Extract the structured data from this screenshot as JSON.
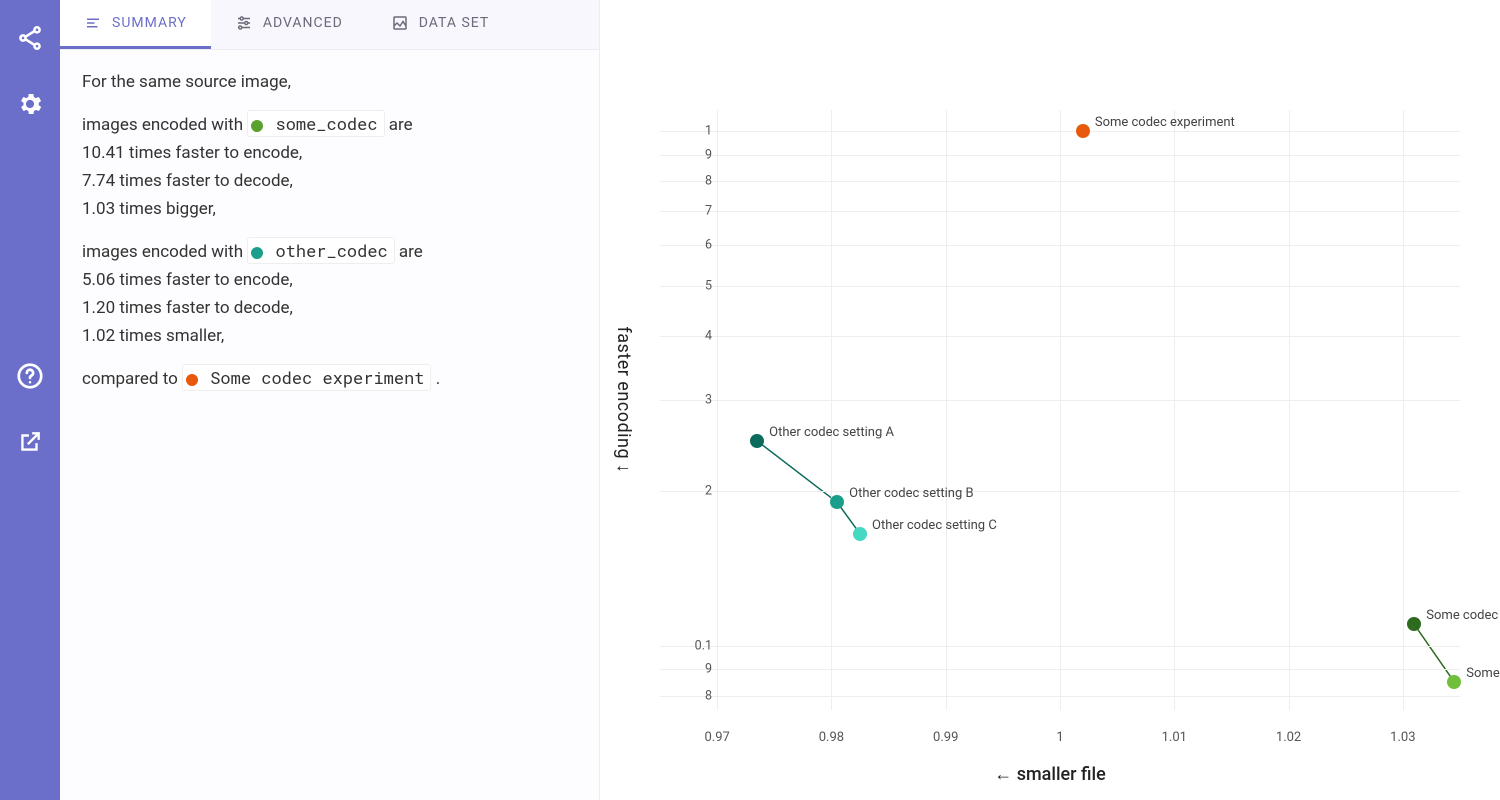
{
  "sidebar": {
    "icons": [
      "share-icon",
      "gear-icon",
      "help-icon",
      "open-external-icon"
    ]
  },
  "tabs": [
    {
      "id": "summary",
      "label": "SUMMARY",
      "active": true,
      "icon": "notes-icon"
    },
    {
      "id": "advanced",
      "label": "ADVANCED",
      "active": false,
      "icon": "tune-icon"
    },
    {
      "id": "dataset",
      "label": "DATA SET",
      "active": false,
      "icon": "image-icon"
    }
  ],
  "summary": {
    "intro": "For the same source image,",
    "codec_a": {
      "prefix": "images encoded with ",
      "name": "some_codec",
      "suffix": " are",
      "dot_color": "#5aa02c",
      "lines": [
        "10.41 times faster to encode,",
        "7.74 times faster to decode,",
        "1.03 times bigger,"
      ]
    },
    "codec_b": {
      "prefix": "images encoded with ",
      "name": "other_codec",
      "suffix": " are",
      "dot_color": "#1b9e8a",
      "lines": [
        "5.06 times faster to encode,",
        "1.20 times faster to decode,",
        "1.02 times smaller,"
      ]
    },
    "baseline": {
      "prefix": "compared to ",
      "name": "Some codec experiment",
      "suffix": " .",
      "dot_color": "#e8590c"
    }
  },
  "chart_data": {
    "type": "scatter",
    "xlabel": "← smaller file",
    "ylabel": "faster encoding ↓",
    "x_ticks": [
      0.97,
      0.98,
      0.99,
      1.0,
      1.01,
      1.02,
      1.03
    ],
    "y_ticks_major": [
      0.1,
      1
    ],
    "y_ticks_minor_upper": [
      9,
      8,
      7,
      6,
      5,
      4,
      3,
      2
    ],
    "y_ticks_minor_lower": [
      0.09,
      0.08
    ],
    "yscale": "log",
    "xlim": [
      0.965,
      1.035
    ],
    "ylim": [
      0.075,
      1.1
    ],
    "series": [
      {
        "name": "baseline",
        "color": "#e8590c",
        "points": [
          {
            "label": "Some codec experiment",
            "x": 1.002,
            "y": 1.0
          }
        ]
      },
      {
        "name": "other_codec",
        "color_gradient": [
          "#0b6b5c",
          "#1b9e8a",
          "#45d9c4"
        ],
        "connected": true,
        "points": [
          {
            "label": "Other codec setting A",
            "x": 0.9735,
            "y": 0.25
          },
          {
            "label": "Other codec setting B",
            "x": 0.9805,
            "y": 0.19
          },
          {
            "label": "Other codec setting C",
            "x": 0.9825,
            "y": 0.165
          }
        ]
      },
      {
        "name": "some_codec",
        "color_gradient": [
          "#2e6b1f",
          "#6fbf3b"
        ],
        "connected": true,
        "points": [
          {
            "label": "Some codec",
            "x": 1.031,
            "y": 0.11,
            "label_truncated": "Some codec"
          },
          {
            "label": "Some",
            "x": 1.0345,
            "y": 0.085,
            "label_truncated": "Some"
          }
        ]
      }
    ]
  }
}
